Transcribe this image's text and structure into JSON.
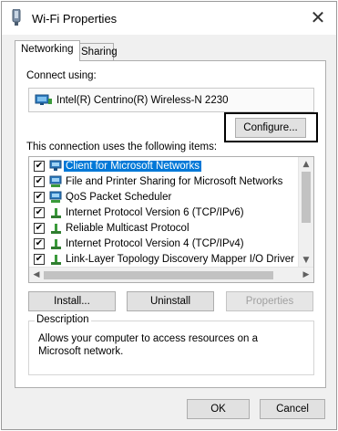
{
  "window": {
    "title": "Wi-Fi Properties",
    "close_glyph": "✕"
  },
  "tabs": [
    {
      "label": "Networking",
      "active": true
    },
    {
      "label": "Sharing",
      "active": false
    }
  ],
  "connect": {
    "label": "Connect using:",
    "adapter": "Intel(R) Centrino(R) Wireless-N 2230",
    "adapter_icon": "network-adapter-icon",
    "configure_label": "Configure..."
  },
  "items": {
    "label": "This connection uses the following items:",
    "list": [
      {
        "label": "Client for Microsoft Networks",
        "checked": true,
        "selected": true,
        "icon": "network-client-icon"
      },
      {
        "label": "File and Printer Sharing for Microsoft Networks",
        "checked": true,
        "selected": false,
        "icon": "network-service-icon"
      },
      {
        "label": "QoS Packet Scheduler",
        "checked": true,
        "selected": false,
        "icon": "network-service-icon"
      },
      {
        "label": "Internet Protocol Version 6 (TCP/IPv6)",
        "checked": true,
        "selected": false,
        "icon": "protocol-icon"
      },
      {
        "label": "Reliable Multicast Protocol",
        "checked": true,
        "selected": false,
        "icon": "protocol-icon"
      },
      {
        "label": "Internet Protocol Version 4 (TCP/IPv4)",
        "checked": true,
        "selected": false,
        "icon": "protocol-icon"
      },
      {
        "label": "Link-Layer Topology Discovery Mapper I/O Driver",
        "checked": true,
        "selected": false,
        "icon": "protocol-icon"
      }
    ],
    "check_glyph": "✔",
    "scroll_up": "▲",
    "scroll_down": "▼",
    "scroll_left": "◀",
    "scroll_right": "▶"
  },
  "actions": {
    "install": "Install...",
    "uninstall": "Uninstall",
    "properties": "Properties"
  },
  "description": {
    "title": "Description",
    "text": "Allows your computer to access resources on a Microsoft network."
  },
  "footer": {
    "ok": "OK",
    "cancel": "Cancel"
  },
  "colors": {
    "selection": "#0078d7",
    "highlight_border": "#000000"
  }
}
